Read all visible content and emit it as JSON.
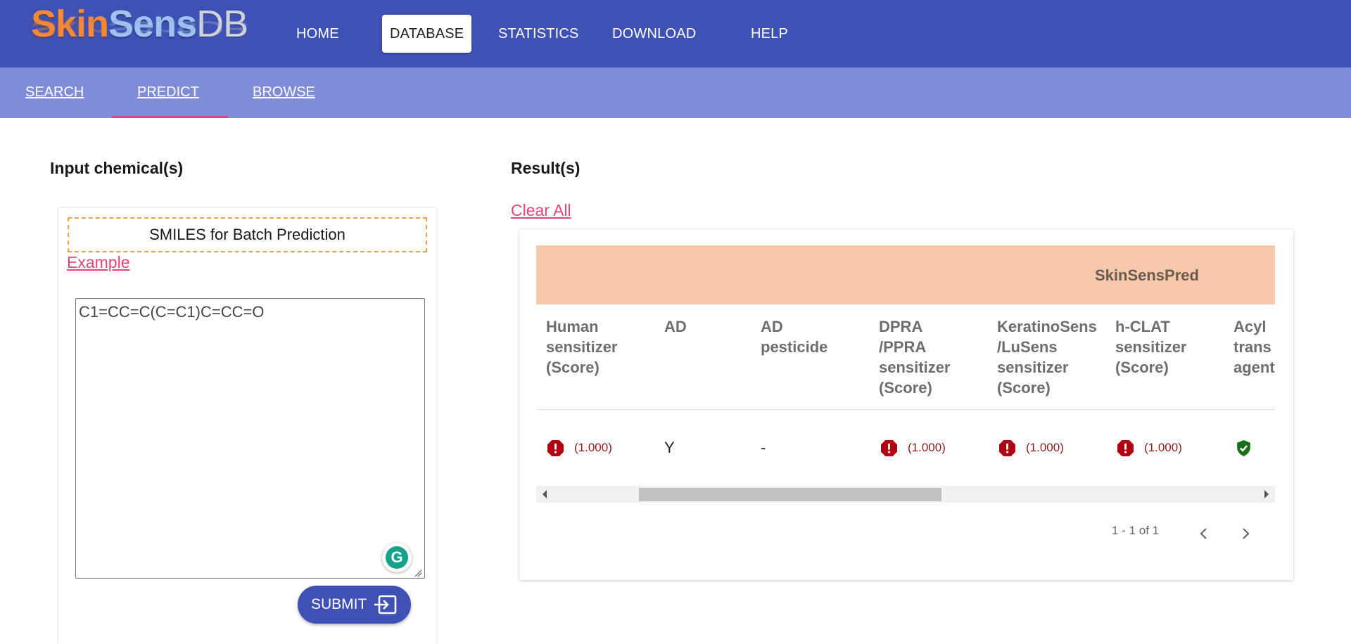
{
  "logo": {
    "part1": "Skin",
    "part2": "Sens",
    "part3": "DB"
  },
  "nav": {
    "home": "HOME",
    "database": "DATABASE",
    "statistics": "STATISTICS",
    "download": "DOWNLOAD",
    "help": "HELP",
    "active": "DATABASE"
  },
  "subnav": {
    "search": "SEARCH",
    "predict": "PREDICT",
    "browse": "BROWSE",
    "active": "PREDICT"
  },
  "input_panel": {
    "title": "Input chemical(s)",
    "batch_label": "SMILES for Batch Prediction",
    "example_link": "Example",
    "smiles_value": "C1=CC=C(C=C1)C=CC=O",
    "submit_label": "SUBMIT",
    "icons": [
      "grammarly-icon",
      "resize-handle-icon",
      "submit-enter-icon"
    ]
  },
  "result_panel": {
    "title": "Result(s)",
    "clear_all": "Clear All",
    "group_header": "SkinSensPred",
    "columns": [
      "Human\nsensitizer\n(Score)",
      "AD",
      "AD\npesticide",
      "DPRA\n/PPRA\nsensitizer\n(Score)",
      "KeratinoSens\n/LuSens\nsensitizer\n(Score)",
      "h-CLAT\nsensitizer\n(Score)",
      "Acyl\ntrans\nagent"
    ],
    "row": {
      "human_score": "(1.000)",
      "ad": "Y",
      "ad_pesticide": "-",
      "dpra_score": "(1.000)",
      "keratino_score": "(1.000)",
      "hclat_score": "(1.000)",
      "acyl_status": "safe"
    },
    "pagination": "1 - 1 of 1",
    "colors": {
      "warning": "#b00012",
      "safe": "#1b6f1b",
      "group_band": "#f7c8aa"
    }
  }
}
